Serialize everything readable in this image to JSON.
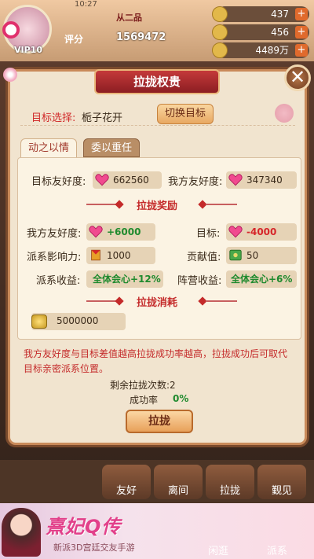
{
  "status_bar": {
    "time": "10:27"
  },
  "player": {
    "vip": "VIP10",
    "rank_tag": "从二品",
    "power_label": "评分",
    "power_value": "1569472"
  },
  "resources": [
    {
      "icon": "medal-icon",
      "value": "437"
    },
    {
      "icon": "gold-ingot-icon",
      "value": "456"
    },
    {
      "icon": "coin-icon",
      "value": "4489万"
    }
  ],
  "dialog": {
    "title": "拉拢权贵",
    "close_glyph": "✕",
    "target_label": "目标选择:",
    "target_name": "栀子花开",
    "switch_button": "切换目标",
    "tabs": [
      "动之以情",
      "委以重任"
    ],
    "target_fav_label": "目标友好度:",
    "target_fav_value": "662560",
    "my_fav_label": "我方友好度:",
    "my_fav_value": "347340",
    "reward_header": "拉拢奖励",
    "reward_my_fav_label": "我方友好度:",
    "reward_my_fav_value": "+6000",
    "reward_target_label": "目标:",
    "reward_target_value": "-4000",
    "faction_influence_label": "派系影响力:",
    "faction_influence_value": "1000",
    "contribution_label": "贡献值:",
    "contribution_value": "50",
    "faction_gain_label": "派系收益:",
    "faction_gain_value": "全体会心+12%",
    "camp_gain_label": "阵营收益:",
    "camp_gain_value": "全体会心+6%",
    "cost_header": "拉拢消耗",
    "cost_value": "5000000",
    "tip": "我方友好度与目标差值越高拉拢成功率越高，拉拢成功后可取代目标亲密派系位置。",
    "remain": "剩余拉拢次数:2",
    "rate_label": "成功率",
    "rate_value": "0%",
    "action_button": "拉拢"
  },
  "bottom_nav": [
    "友好",
    "离间",
    "拉拢",
    "觐见"
  ],
  "bottom_nav_lower": [
    "闲逛",
    "派系"
  ],
  "ad": {
    "title": "熹妃Q传",
    "subtitle": "新派3D宫廷交友手游"
  }
}
